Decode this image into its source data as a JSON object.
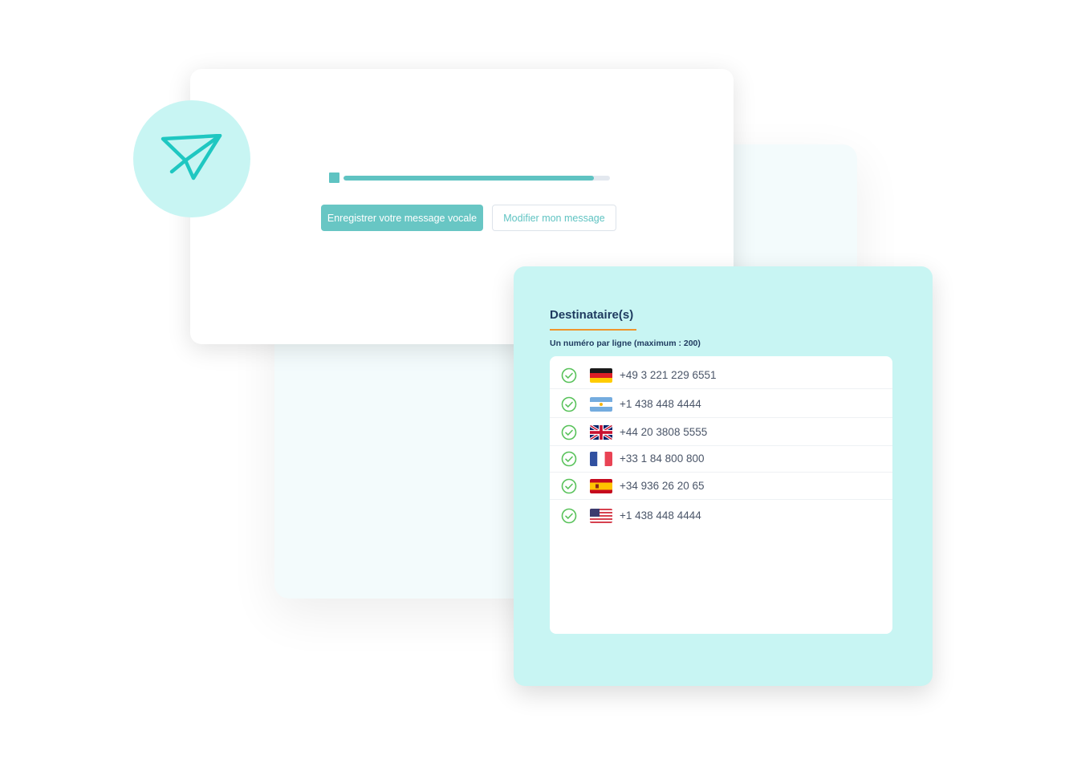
{
  "main_card": {
    "progress_percent": 94,
    "record_button_label": "Enregistrer votre message vocale",
    "edit_button_label": "Modifier mon message",
    "icon": "paper-plane-icon"
  },
  "recipients": {
    "title": "Destinataire(s)",
    "subtitle": "Un numéro par ligne (maximum : 200)",
    "items": [
      {
        "flag": "germany-flag-icon",
        "number": "+49 3 221 229 6551",
        "status": "check-circle-icon"
      },
      {
        "flag": "argentina-flag-icon",
        "number": "+1 438 448 4444",
        "status": "check-circle-icon"
      },
      {
        "flag": "uk-flag-icon",
        "number": "+44 20 3808 5555",
        "status": "check-circle-icon"
      },
      {
        "flag": "france-flag-icon",
        "number": "+33 1 84 800 800",
        "status": "check-circle-icon"
      },
      {
        "flag": "spain-flag-icon",
        "number": "+34 936 26 20 65",
        "status": "check-circle-icon"
      },
      {
        "flag": "usa-flag-icon",
        "number": "+1 438 448 4444",
        "status": "check-circle-icon"
      }
    ]
  },
  "colors": {
    "accent": "#5fc3c2",
    "mint_background": "#c8f5f3",
    "title_navy": "#1e3a5f",
    "underline_orange": "#f0952c",
    "check_green": "#58c25a",
    "icon_teal": "#1fc7c1"
  }
}
